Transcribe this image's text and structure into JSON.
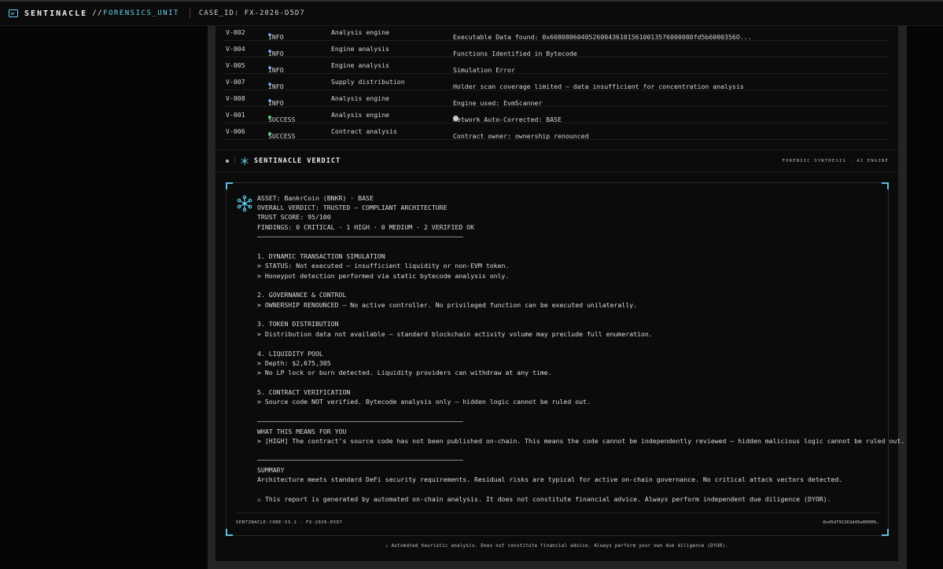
{
  "header": {
    "brand": "SENTINACLE",
    "sub_slashes": "//",
    "sub": "FORENSICS_UNIT",
    "case": "CASE_ID: FX-2026-D5D7"
  },
  "findings": [
    {
      "id": "V-002",
      "severity": "INFO",
      "source": "Analysis engine",
      "message": "Executable Data found: 0x6080806040526004361015610013576000080fd5b6000356O..."
    },
    {
      "id": "V-004",
      "severity": "INFO",
      "source": "Engine analysis",
      "message": "Functions Identified in Bytecode"
    },
    {
      "id": "V-005",
      "severity": "INFO",
      "source": "Engine analysis",
      "message": "Simulation Error"
    },
    {
      "id": "V-007",
      "severity": "INFO",
      "source": "Supply distribution",
      "message": "Holder scan coverage limited — data insufficient for concentration analysis"
    },
    {
      "id": "V-008",
      "severity": "INFO",
      "source": "Analysis engine",
      "message": "Engine used: EvmScanner"
    },
    {
      "id": "V-001",
      "severity": "SUCCESS",
      "source": "Analysis engine",
      "message": "Network Auto-Corrected: BASE"
    },
    {
      "id": "V-006",
      "severity": "SUCCESS",
      "source": "Contract analysis",
      "message": "Contract owner: ownership renounced"
    }
  ],
  "colors": {
    "info": "#5b86e0",
    "success": "#3fc46a",
    "accent": "#5cc0e0"
  },
  "verdict": {
    "title": "SENTINACLE VERDICT",
    "tag": "FORENSIC SYNTHESIS · AI ENGINE"
  },
  "report": {
    "asset": "ASSET: BankrCoin (BNKR) · BASE",
    "overall": "OVERALL VERDICT: TRUSTED — COMPLIANT ARCHITECTURE",
    "trust": "TRUST SCORE: 95/100",
    "findings": "FINDINGS: 0 CRITICAL · 1 HIGH · 0 MEDIUM · 2 VERIFIED OK",
    "s1_title": "1. DYNAMIC TRANSACTION SIMULATION",
    "s1_l1": "> STATUS: Not executed — insufficient liquidity or non-EVM token.",
    "s1_l2": "> Honeypot detection performed via static bytecode analysis only.",
    "s2_title": "2. GOVERNANCE & CONTROL",
    "s2_l1": "> OWNERSHIP RENOUNCED — No active controller. No privileged function can be executed unilaterally.",
    "s3_title": "3. TOKEN DISTRIBUTION",
    "s3_l1": "> Distribution data not available — standard blockchain activity volume may preclude full enumeration.",
    "s4_title": "4. LIQUIDITY POOL",
    "s4_l1": "> Depth: $2,675,305",
    "s4_l2": "> No LP lock or burn detected. Liquidity providers can withdraw at any time.",
    "s5_title": "5. CONTRACT VERIFICATION",
    "s5_l1": "> Source code NOT verified. Bytecode analysis only — hidden logic cannot be ruled out.",
    "means_title": "WHAT THIS MEANS FOR YOU",
    "means_l1": "> [HIGH] The contract's source code has not been published on-chain. This means the code cannot be independently reviewed — hidden malicious logic cannot be ruled out.",
    "summary_title": "SUMMARY",
    "summary_l1": "Architecture meets standard DeFi security requirements. Residual risks are typical for active on-chain governance. No critical attack vectors detected.",
    "warning": "⚠ This report is generated by automated on-chain analysis. It does not constitute financial advice. Always perform independent due diligence (DYOR)."
  },
  "card_footer": {
    "left": "SENTINACLE-CORE-V3.1 · FX-2026-D5D7",
    "right": "0xd5d791363d45e80000…"
  },
  "disclaimer": "⚠ Automated heuristic analysis. Does not constitute financial advice. Always perform your own due diligence (DYOR)."
}
